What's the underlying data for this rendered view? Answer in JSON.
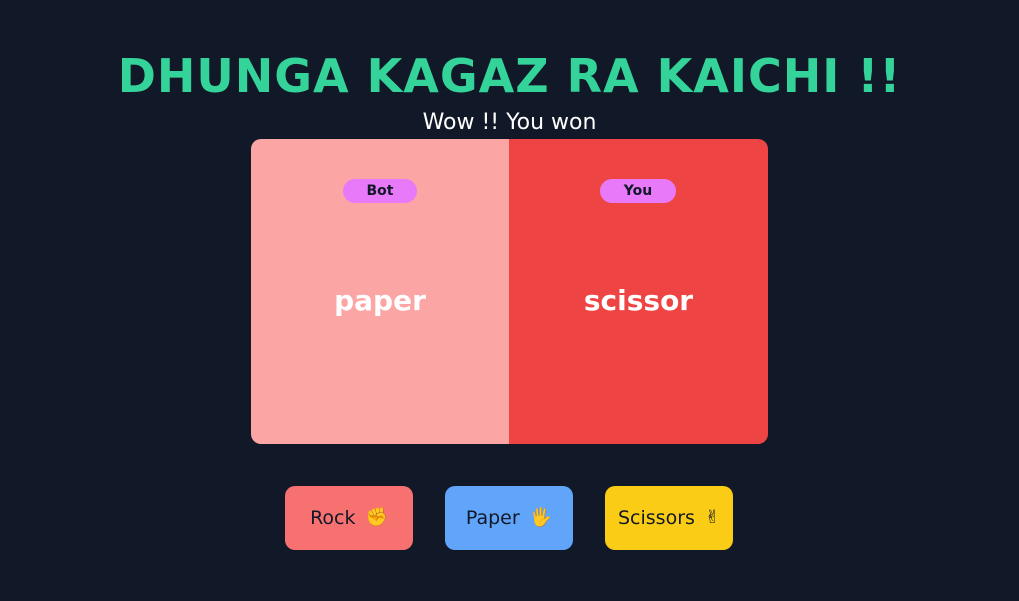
{
  "title": "DHUNGA KAGAZ RA KAICHI !!",
  "result_text": "Wow !! You won",
  "board": {
    "bot": {
      "badge": "Bot",
      "choice": "paper",
      "color": "#fca5a5"
    },
    "you": {
      "badge": "You",
      "choice": "scissor",
      "color": "#ef4444"
    }
  },
  "buttons": [
    {
      "label": "Rock",
      "icon": "raised-fist-icon",
      "glyph": "✊",
      "color": "#f87171"
    },
    {
      "label": "Paper",
      "icon": "raised-hand-icon",
      "glyph": "🖐",
      "color": "#60a5fa"
    },
    {
      "label": "Scissors",
      "icon": "victory-hand-icon",
      "glyph": "✌",
      "color": "#facc15"
    }
  ],
  "colors": {
    "background": "#111827",
    "title": "#34d399",
    "badge": "#e879f9"
  }
}
